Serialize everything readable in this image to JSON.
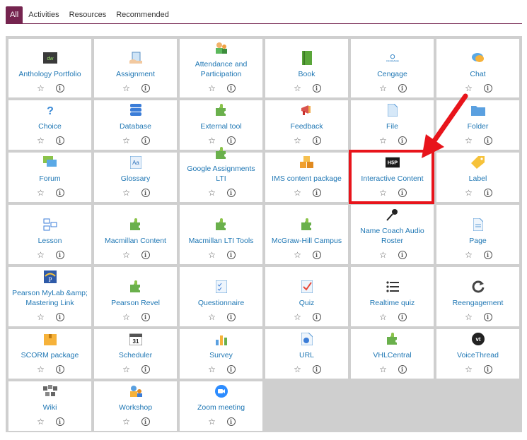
{
  "tabs": [
    {
      "label": "All",
      "active": true
    },
    {
      "label": "Activities",
      "active": false
    },
    {
      "label": "Resources",
      "active": false
    },
    {
      "label": "Recommended",
      "active": false
    }
  ],
  "tiles": [
    {
      "label": "Anthology Portfolio",
      "icon": "dw-icon"
    },
    {
      "label": "Assignment",
      "icon": "assignment-icon"
    },
    {
      "label": "Attendance and Participation",
      "icon": "attendance-icon"
    },
    {
      "label": "Book",
      "icon": "book-icon"
    },
    {
      "label": "Cengage",
      "icon": "cengage-icon"
    },
    {
      "label": "Chat",
      "icon": "chat-icon"
    },
    {
      "label": "Choice",
      "icon": "question-icon"
    },
    {
      "label": "Database",
      "icon": "database-icon"
    },
    {
      "label": "External tool",
      "icon": "puzzle-icon"
    },
    {
      "label": "Feedback",
      "icon": "megaphone-icon"
    },
    {
      "label": "File",
      "icon": "file-icon"
    },
    {
      "label": "Folder",
      "icon": "folder-icon"
    },
    {
      "label": "Forum",
      "icon": "forum-icon"
    },
    {
      "label": "Glossary",
      "icon": "glossary-icon"
    },
    {
      "label": "Google Assignments LTI",
      "icon": "puzzle-icon"
    },
    {
      "label": "IMS content package",
      "icon": "package-icon"
    },
    {
      "label": "Interactive Content",
      "icon": "h5p-icon",
      "icon_text": "H5P"
    },
    {
      "label": "Label",
      "icon": "tag-icon"
    },
    {
      "label": "Lesson",
      "icon": "lesson-icon"
    },
    {
      "label": "Macmillan Content",
      "icon": "puzzle-icon"
    },
    {
      "label": "Macmillan LTI Tools",
      "icon": "puzzle-icon"
    },
    {
      "label": "McGraw-Hill Campus",
      "icon": "puzzle-icon"
    },
    {
      "label": "Name Coach Audio Roster",
      "icon": "microphone-icon"
    },
    {
      "label": "Page",
      "icon": "page-icon"
    },
    {
      "label": "Pearson MyLab &amp; Mastering Link",
      "icon": "pearson-icon"
    },
    {
      "label": "Pearson Revel",
      "icon": "puzzle-icon"
    },
    {
      "label": "Questionnaire",
      "icon": "questionnaire-icon"
    },
    {
      "label": "Quiz",
      "icon": "quiz-icon"
    },
    {
      "label": "Realtime quiz",
      "icon": "list-icon"
    },
    {
      "label": "Reengagement",
      "icon": "reengagement-icon"
    },
    {
      "label": "SCORM package",
      "icon": "scorm-icon"
    },
    {
      "label": "Scheduler",
      "icon": "calendar-icon",
      "icon_text": "31"
    },
    {
      "label": "Survey",
      "icon": "survey-chart-icon"
    },
    {
      "label": "URL",
      "icon": "url-icon"
    },
    {
      "label": "VHLCentral",
      "icon": "puzzle-icon"
    },
    {
      "label": "VoiceThread",
      "icon": "voicethread-icon",
      "icon_text": "vt"
    },
    {
      "label": "Wiki",
      "icon": "wiki-icon"
    },
    {
      "label": "Workshop",
      "icon": "workshop-icon"
    },
    {
      "label": "Zoom meeting",
      "icon": "zoom-icon"
    }
  ],
  "colors": {
    "accent": "#75244f",
    "link": "#1f77b4",
    "highlight": "#e8141b",
    "grid_bg": "#cfcfcf"
  }
}
